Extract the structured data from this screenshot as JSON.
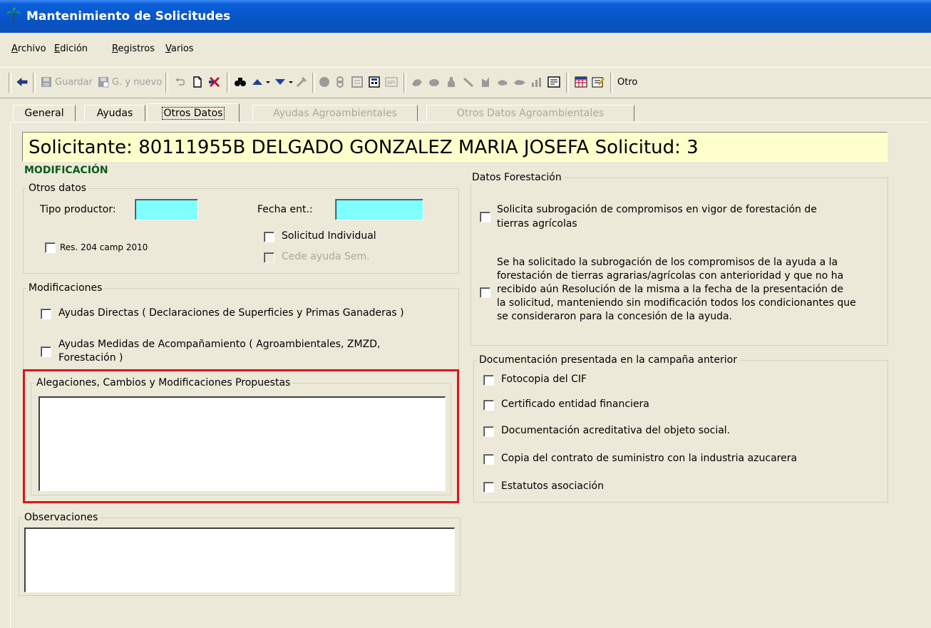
{
  "window": {
    "title": "Mantenimiento de Solicitudes"
  },
  "menu": [
    {
      "label": "Archivo",
      "accel": "A",
      "rest": "rchivo"
    },
    {
      "label": "Edición",
      "accel": "E",
      "rest": "dición"
    },
    {
      "label": "Registros",
      "accel": "R",
      "rest": "egistros"
    },
    {
      "label": "Varios",
      "accel": "V",
      "rest": "arios"
    }
  ],
  "toolbar": {
    "guardar": "Guardar",
    "gnuevo": "G. y nuevo",
    "otros": "Otro"
  },
  "tabs": [
    {
      "label": "General",
      "state": "normal"
    },
    {
      "label": "Ayudas",
      "state": "normal"
    },
    {
      "label": "Otros Datos",
      "state": "active"
    },
    {
      "label": "Ayudas Agroambientales",
      "state": "disabled"
    },
    {
      "label": "Otros Datos Agroambientales",
      "state": "disabled"
    }
  ],
  "header": {
    "solicitante": "Solicitante: 80111955B  DELGADO GONZALEZ MARIA JOSEFA Solicitud:  3",
    "mode": "MODIFICACIÓN"
  },
  "otros_datos": {
    "legend": "Otros datos",
    "tipo_productor_label": "Tipo productor:",
    "tipo_productor_value": "",
    "fecha_ent_label": "Fecha  ent.:",
    "fecha_ent_value": "",
    "res_label": "Res.  204 camp 2010",
    "solicitud_individual_label": "Solicitud Individual",
    "cede_ayuda_label": "Cede ayuda Sem."
  },
  "modificaciones": {
    "legend": "Modificaciones",
    "ayudas_directas": "Ayudas Directas ( Declaraciones de Superficies y Primas Ganaderas )",
    "ayudas_medidas_line1": "Ayudas Medidas de Acompañamiento ( Agroambientales, ZMZD,",
    "ayudas_medidas_line2": "Forestación )",
    "alegaciones_legend": "Alegaciones, Cambios y Modificaciones Propuestas",
    "alegaciones_value": ""
  },
  "observaciones": {
    "legend": "Observaciones",
    "value": ""
  },
  "forestacion": {
    "legend": "Datos Forestación",
    "subrogacion_line1": "Solicita subrogación de compromisos en vigor de forestación de",
    "subrogacion_line2": "tierras agrícolas",
    "para_line1": "Se ha solicitado la subrogación de los compromisos de la ayuda a la",
    "para_line2": "forestación de tierras agrarias/agrícolas con anterioridad y que no ha",
    "para_line3": "recibido aún Resolución de la misma a la fecha de la presentación de",
    "para_line4": "la solicitud, manteniendo sin modificación todos los condicionantes que",
    "para_line5": "se consideraron para la concesión de la ayuda."
  },
  "documentacion": {
    "legend": "Documentación presentada en la campaña anterior",
    "items": [
      "Fotocopia del CIF",
      "Certificado entidad financiera",
      "Documentación acreditativa del objeto social.",
      "Copia del contrato de suministro con la industria azucarera",
      "Estatutos asociación"
    ]
  },
  "colors": {
    "titlebar": "#0754c6",
    "header_bg": "#ffffcc",
    "mode_text": "#0b5a1a",
    "cyan_field": "#80ffff",
    "highlight_border": "#e0141a"
  }
}
